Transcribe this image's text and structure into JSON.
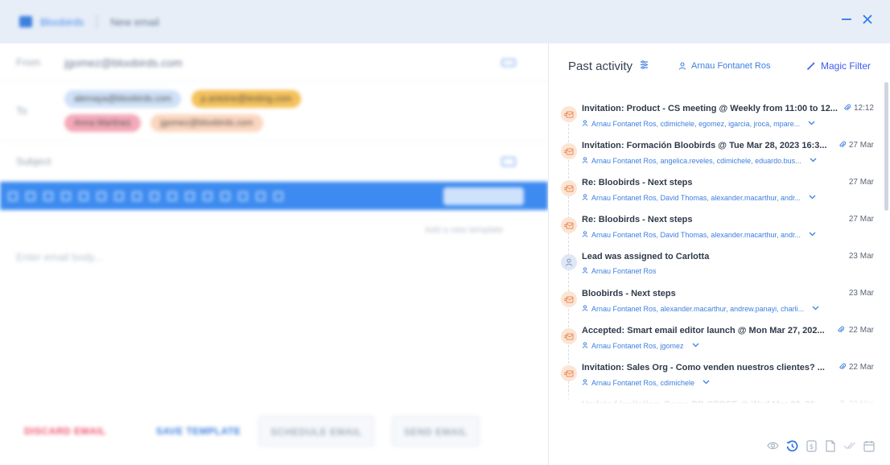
{
  "header": {
    "brand": "Bloobirds",
    "title": "New email",
    "minimize_label": "—",
    "close_label": "✕"
  },
  "composer": {
    "from_label": "From",
    "from_value": "jgomez@bloobirds.com",
    "to_label": "To",
    "recipients": [
      "alemaya@bloobirds.com",
      "p.antoine@testing.com",
      "Anna Martinez",
      "jgomez@bloobirds.com"
    ],
    "subject_label": "Subject",
    "add_template": "Add a new template",
    "body_placeholder": "Enter email body...",
    "discard_label": "DISCARD EMAIL",
    "save_template_label": "SAVE TEMPLATE",
    "schedule_label": "SCHEDULE EMAIL",
    "send_label": "SEND EMAIL",
    "preview_label": "PREVIEW",
    "colors": {
      "toolbar": "#3d8bf0",
      "discard": "#f0506e",
      "save": "#3d7fdf"
    }
  },
  "panel": {
    "title": "Past activity",
    "user": "Arnau Fontanet Ros",
    "magic_filter": "Magic Filter",
    "items": [
      {
        "type": "email",
        "title": "Invitation: Product - CS meeting @ Weekly from 11:00 to 12...",
        "attachment": true,
        "date": "12:12",
        "participants": "Arnau Fontanet Ros, cdimichele, egomez, igarcia, jroca, mpare..."
      },
      {
        "type": "email",
        "title": "Invitation: Formación Bloobirds @ Tue Mar 28, 2023 16:3...",
        "attachment": true,
        "date": "27 Mar",
        "participants": "Arnau Fontanet Ros, angelica.reveles, cdimichele, eduardo.bus..."
      },
      {
        "type": "email",
        "title": "Re: Bloobirds - Next steps",
        "attachment": false,
        "date": "27 Mar",
        "participants": "Arnau Fontanet Ros, David Thomas, alexander.macarthur, andr..."
      },
      {
        "type": "email",
        "title": "Re: Bloobirds - Next steps",
        "attachment": false,
        "date": "27 Mar",
        "participants": "Arnau Fontanet Ros, David Thomas, alexander.macarthur, andr..."
      },
      {
        "type": "lead",
        "title": "Lead was assigned to Carlotta",
        "attachment": false,
        "date": "23 Mar",
        "participants": "Arnau Fontanet Ros"
      },
      {
        "type": "email",
        "title": "Bloobirds - Next steps",
        "attachment": false,
        "date": "23 Mar",
        "participants": "Arnau Fontanet Ros, alexander.macarthur, andrew.panayi, charli..."
      },
      {
        "type": "email",
        "title": "Accepted: Smart email editor launch @ Mon Mar 27, 202...",
        "attachment": true,
        "date": "22 Mar",
        "participants": "Arnau Fontanet Ros, jgomez"
      },
      {
        "type": "email",
        "title": "Invitation: Sales Org - Como venden nuestros clientes? ...",
        "attachment": true,
        "date": "22 Mar",
        "participants": "Arnau Fontanet Ros, cdimichele"
      },
      {
        "type": "email",
        "title": "Updated invitation: Demo BB OTOSE @ Wed Mar 22, 20...",
        "attachment": true,
        "date": "22 Mar",
        "participants": ""
      }
    ],
    "bottom_icons": [
      "eye-icon",
      "history-icon",
      "dollar-icon",
      "file-icon",
      "double-check-icon",
      "calendar-icon"
    ]
  }
}
